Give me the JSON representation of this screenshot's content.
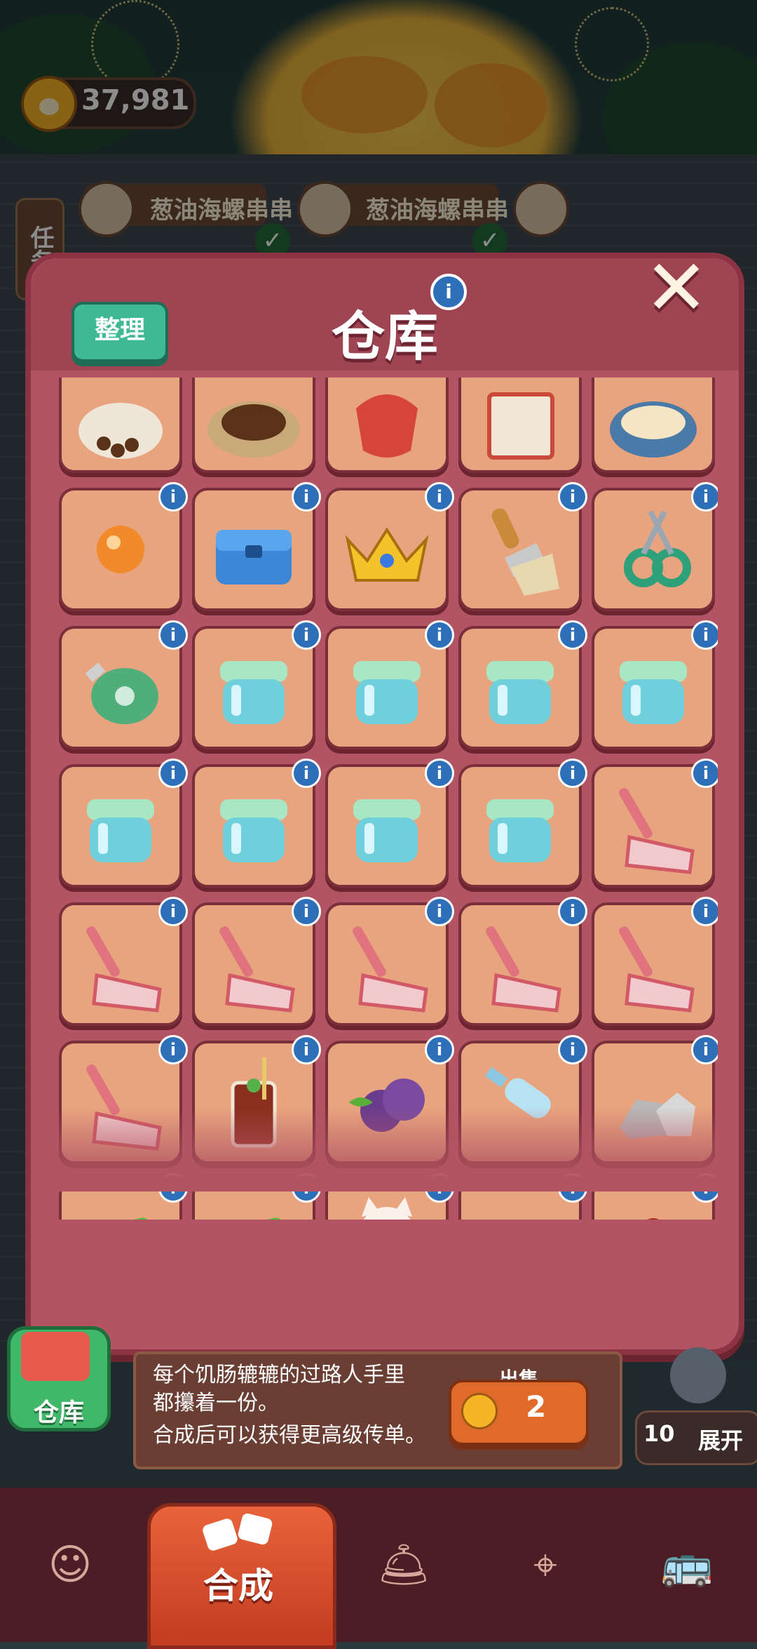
{
  "hud": {
    "coins": "37,981"
  },
  "orders": [
    {
      "name": "葱油海螺串串"
    },
    {
      "name": "葱油海螺串串"
    }
  ],
  "task_tab": {
    "label": "任务"
  },
  "panel": {
    "title": "仓库",
    "sort_label": "整理",
    "info_glyph": "i",
    "close_glyph": "✕"
  },
  "items": [
    {
      "icon": "coffee-beans-sack-icon"
    },
    {
      "icon": "coffee-bowl-icon"
    },
    {
      "icon": "red-pouch-icon"
    },
    {
      "icon": "painting-scroll-icon"
    },
    {
      "icon": "noodle-bowl-icon"
    },
    {
      "icon": "orange-ball-icon",
      "info": true
    },
    {
      "icon": "blue-bag-icon",
      "info": true
    },
    {
      "icon": "gold-crown-icon",
      "info": true
    },
    {
      "icon": "paint-brush-icon",
      "info": true
    },
    {
      "icon": "scissors-icon",
      "info": true
    },
    {
      "icon": "tape-measure-icon",
      "info": true
    },
    {
      "icon": "glass-jar-icon",
      "info": true
    },
    {
      "icon": "glass-jar-icon",
      "info": true
    },
    {
      "icon": "glass-jar-icon",
      "info": true
    },
    {
      "icon": "glass-jar-icon",
      "info": true
    },
    {
      "icon": "glass-jar-icon",
      "info": true
    },
    {
      "icon": "glass-jar-icon",
      "info": true
    },
    {
      "icon": "glass-jar-icon",
      "info": true
    },
    {
      "icon": "glass-jar-icon",
      "info": true
    },
    {
      "icon": "dustpan-icon",
      "info": true
    },
    {
      "icon": "dustpan-icon",
      "info": true
    },
    {
      "icon": "dustpan-icon",
      "info": true
    },
    {
      "icon": "dustpan-icon",
      "info": true
    },
    {
      "icon": "dustpan-icon",
      "info": true
    },
    {
      "icon": "dustpan-icon",
      "info": true
    },
    {
      "icon": "dustpan-icon",
      "info": true
    },
    {
      "icon": "iced-drink-icon",
      "info": true
    },
    {
      "icon": "blackberries-icon",
      "info": true
    },
    {
      "icon": "glass-bottle-icon",
      "info": true
    },
    {
      "icon": "rocks-icon",
      "info": true
    },
    {
      "icon": "battery-card-icon",
      "info": true
    },
    {
      "icon": "battery-card-icon",
      "info": true
    },
    {
      "icon": "lucky-cat-icon",
      "info": true
    },
    {
      "icon": "wooden-crate-icon",
      "info": true
    },
    {
      "icon": "red-box-icon",
      "info": true
    }
  ],
  "item_detail": {
    "description_line1": "每个饥肠辘辘的过路人手里都攥着一份。",
    "description_line2": "合成后可以获得更高级传单。",
    "sell_label": "出售",
    "sell_price": "2"
  },
  "warehouse_button": {
    "label": "仓库"
  },
  "expand": {
    "count": "10",
    "label": "展开"
  },
  "bottom_tabs": [
    {
      "icon": "shop-bag-icon"
    },
    {
      "label": "合成",
      "icon": "merge-icon",
      "active": true
    },
    {
      "icon": "service-bell-icon"
    },
    {
      "icon": "map-pin-icon"
    },
    {
      "icon": "bus-icon"
    }
  ],
  "colors": {
    "panel": "#b25463",
    "cell": "#e8a47f",
    "accent_green": "#3fb894",
    "info_blue": "#2d6fb8"
  }
}
